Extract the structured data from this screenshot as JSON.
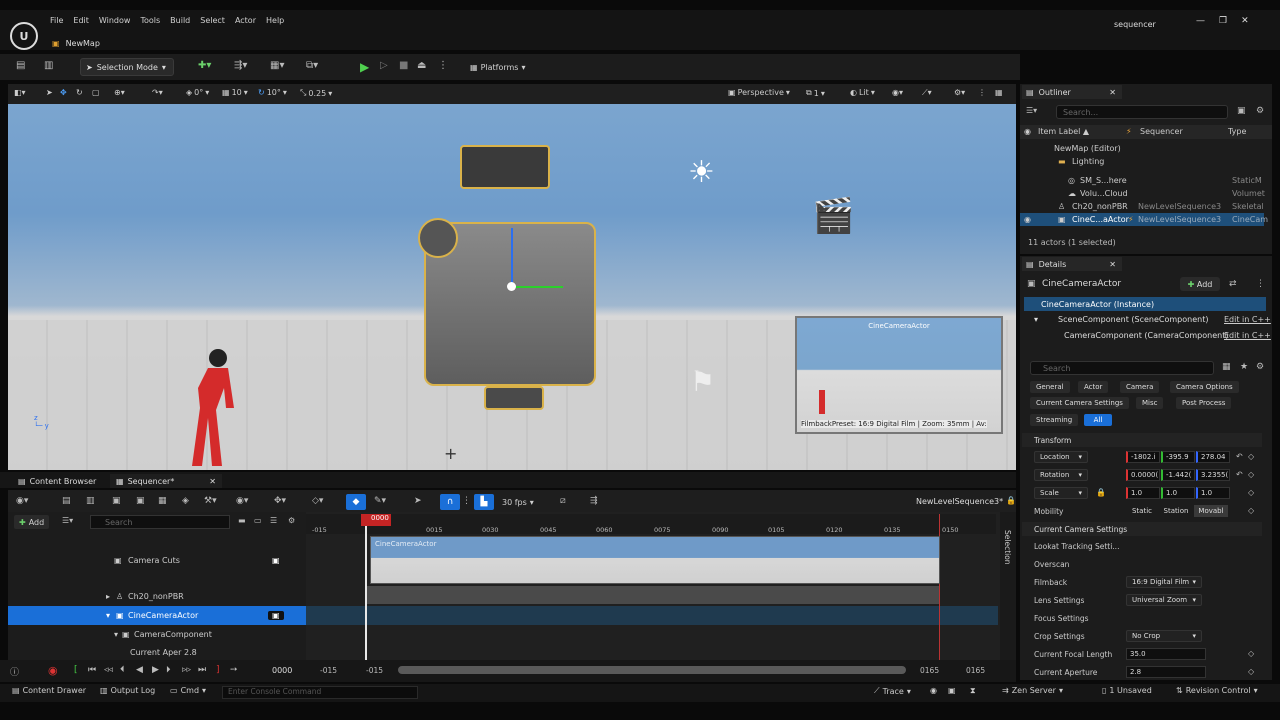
{
  "menu": [
    "File",
    "Edit",
    "Window",
    "Tools",
    "Build",
    "Select",
    "Actor",
    "Help"
  ],
  "map_tab": "NewMap",
  "window_title": "sequencer",
  "toolbar": {
    "selection_mode": "Selection Mode",
    "platforms": "Platforms"
  },
  "viewport_tools": {
    "angle": "0°",
    "grid": "10",
    "rotate": "10°",
    "scale": "0.25",
    "perspective": "Perspective",
    "lit": "Lit",
    "fov": "1"
  },
  "preview": {
    "title": "CineCameraActor",
    "footer": "FilmbackPreset: 16:9 Digital Film | Zoom: 35mm | Av:"
  },
  "outliner": {
    "tab": "Outliner",
    "search_placeholder": "Search...",
    "columns": {
      "label": "Item Label ▲",
      "sequencer": "Sequencer",
      "type": "Type"
    },
    "rows": [
      {
        "label": "NewMap (Editor)",
        "sequencer": "",
        "type": ""
      },
      {
        "label": "Lighting",
        "sequencer": "",
        "type": ""
      },
      {
        "label": "SM_S...here",
        "sequencer": "",
        "type": "StaticM"
      },
      {
        "label": "Volu...Cloud",
        "sequencer": "",
        "type": "Volumet"
      },
      {
        "label": "Ch20_nonPBR",
        "sequencer": "NewLevelSequence3",
        "type": "Skeletal"
      },
      {
        "label": "CineC...aActor",
        "sequencer": "NewLevelSequence3",
        "type": "CineCam"
      }
    ],
    "count": "11 actors (1 selected)"
  },
  "details": {
    "tab": "Details",
    "title": "CineCameraActor",
    "add": "Add",
    "instance": "CineCameraActor (Instance)",
    "components": [
      {
        "name": "SceneComponent (SceneComponent)",
        "link": "Edit in C++"
      },
      {
        "name": "CameraComponent (CameraComponent)",
        "link": "Edit in C++"
      }
    ],
    "search_placeholder": "Search",
    "filters": [
      "General",
      "Actor",
      "Camera",
      "Camera Options",
      "Current Camera Settings",
      "Misc",
      "Post Process",
      "Streaming",
      "All"
    ],
    "transform": "Transform",
    "location": {
      "label": "Location",
      "x": "-1802.i",
      "y": "-395.9",
      "z": "278.04"
    },
    "rotation": {
      "label": "Rotation",
      "x": "0.0000(",
      "y": "-1.442(",
      "z": "3.2355("
    },
    "scale": {
      "label": "Scale",
      "x": "1.0",
      "y": "1.0",
      "z": "1.0"
    },
    "mobility": {
      "label": "Mobility",
      "static": "Static",
      "station": "Station",
      "movable": "Movabl"
    },
    "ccs": "Current Camera Settings",
    "lookat": "Lookat Tracking Setti...",
    "overscan": "Overscan",
    "filmback": {
      "label": "Filmback",
      "value": "16:9 Digital Film"
    },
    "lens": {
      "label": "Lens Settings",
      "value": "Universal Zoom"
    },
    "focus": "Focus Settings",
    "crop": {
      "label": "Crop Settings",
      "value": "No Crop"
    },
    "focal": {
      "label": "Current Focal Length",
      "value": "35.0"
    },
    "aperture": {
      "label": "Current Aperture",
      "value": "2.8"
    }
  },
  "bottom_tabs": {
    "content_browser": "Content Browser",
    "sequencer": "Sequencer*"
  },
  "sequencer": {
    "add": "Add",
    "search_placeholder": "Search",
    "fps": "30 fps",
    "sequence_name": "NewLevelSequence3*",
    "current_frame": "0000",
    "ticks": [
      "-015",
      "0015",
      "0030",
      "0045",
      "0060",
      "0075",
      "0090",
      "0105",
      "0120",
      "0135",
      "0150"
    ],
    "tracks": [
      "Camera Cuts",
      "Ch20_nonPBR",
      "CineCameraActor",
      "CameraComponent",
      "Current Aper"
    ],
    "aper_value": "2.8",
    "shot_label": "CineCameraActor",
    "play_frame": "0000",
    "range_start": "-015",
    "range_start2": "-015",
    "range_end": "0165",
    "range_end2": "0165",
    "side_label": "Selection"
  },
  "status": {
    "content_drawer": "Content Drawer",
    "output_log": "Output Log",
    "cmd": "Cmd",
    "console_placeholder": "Enter Console Command",
    "trace": "Trace",
    "zen": "Zen Server",
    "unsaved": "1 Unsaved",
    "revision": "Revision Control"
  }
}
